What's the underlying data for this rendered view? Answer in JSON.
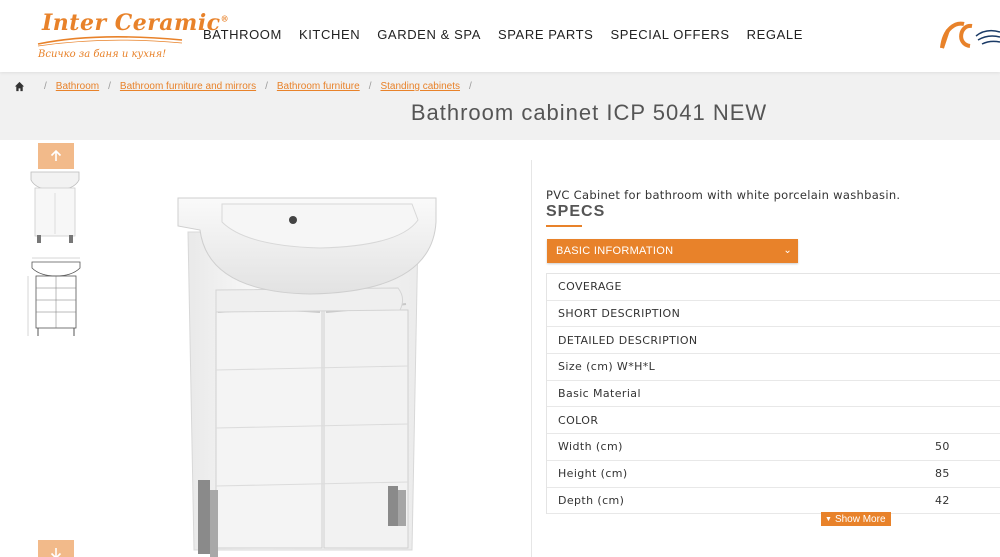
{
  "logo": {
    "title": "Inter Ceramic",
    "tm": "®",
    "tagline": "Всичко за баня и кухня!"
  },
  "nav": {
    "items": [
      "BATHROOM",
      "KITCHEN",
      "GARDEN & SPA",
      "SPARE PARTS",
      "SPECIAL OFFERS",
      "REGALE"
    ]
  },
  "breadcrumb": {
    "home_icon": "home-icon",
    "items": [
      "Bathroom",
      "Bathroom furniture and mirrors",
      "Bathroom furniture",
      "Standing cabinets"
    ]
  },
  "product": {
    "title": "Bathroom cabinet ICP 5041 NEW",
    "description": "PVC Cabinet for bathroom with white porcelain washbasin."
  },
  "specs": {
    "title": "SPECS",
    "accordion_label": "BASIC INFORMATION",
    "rows": [
      {
        "label": "COVERAGE",
        "value": ""
      },
      {
        "label": "SHORT DESCRIPTION",
        "value": ""
      },
      {
        "label": "DETAILED DESCRIPTION",
        "value": ""
      },
      {
        "label": "Size (cm) W*H*L",
        "value": ""
      },
      {
        "label": "Basic Material",
        "value": ""
      },
      {
        "label": "COLOR",
        "value": ""
      },
      {
        "label": "Width (cm)",
        "value": "50"
      },
      {
        "label": "Height (cm)",
        "value": "85"
      },
      {
        "label": "Depth (cm)",
        "value": "42"
      }
    ],
    "show_more": "Show More"
  },
  "colors": {
    "accent": "#e8822a",
    "band": "#f1f1f1"
  }
}
